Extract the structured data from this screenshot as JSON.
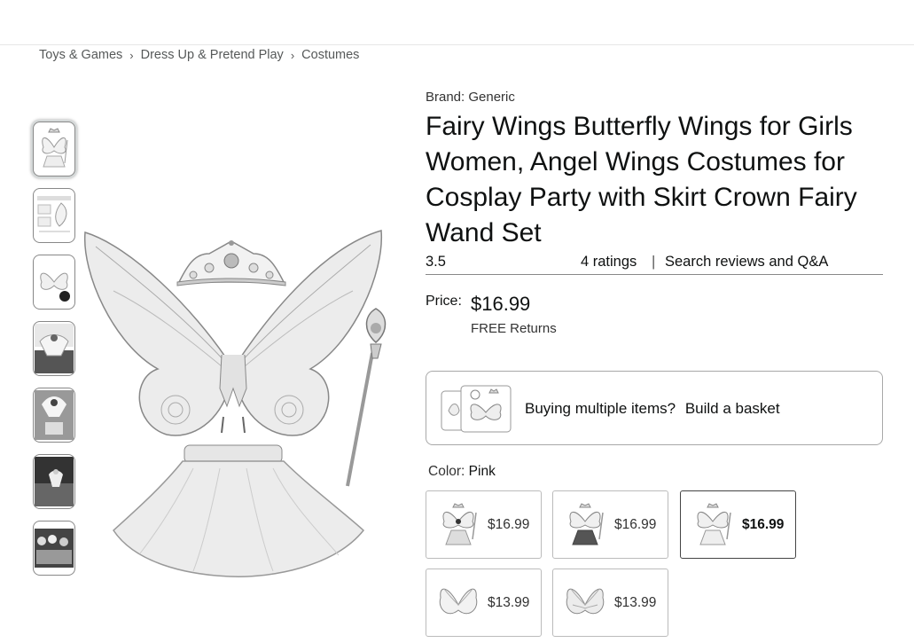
{
  "breadcrumb": [
    "Toys & Games",
    "Dress Up & Pretend Play",
    "Costumes"
  ],
  "breadcrumb_separator": "›",
  "product": {
    "brand": "Brand: Generic",
    "title": "Fairy Wings Butterfly Wings for Girls Women, Angel Wings Costumes for Cosplay Party with Skirt Crown Fairy Wand Set",
    "rating": "3.5",
    "ratings_count": "4 ratings",
    "divider": "|",
    "search_reviews": "Search reviews and Q&A",
    "price_label": "Price:",
    "price": "$16.99",
    "returns": "FREE Returns"
  },
  "basket": {
    "question": "Buying multiple items?",
    "link": "Build a basket"
  },
  "color": {
    "label": "Color:",
    "value": "Pink",
    "options": [
      {
        "price": "$16.99",
        "selected": false
      },
      {
        "price": "$16.99",
        "selected": false
      },
      {
        "price": "$16.99",
        "selected": true
      },
      {
        "price": "$13.99",
        "selected": false
      },
      {
        "price": "$13.99",
        "selected": false
      }
    ]
  },
  "thumbnails": [
    "wings-set-icon",
    "size-chart-icon",
    "wings-icon",
    "wings-worn-icon",
    "wings-worn-icon",
    "wings-outdoor-icon",
    "group-photo-icon"
  ]
}
